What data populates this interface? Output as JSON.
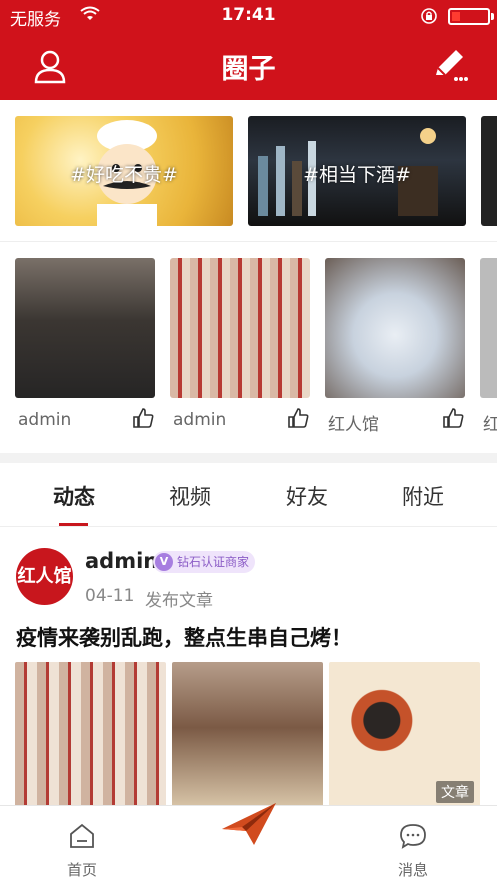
{
  "status_bar": {
    "carrier": "无服务",
    "time": "17:41"
  },
  "nav": {
    "title": "圈子"
  },
  "banners": [
    {
      "label": "#好吃不贵#"
    },
    {
      "label": "#相当下酒#"
    }
  ],
  "feed_cards": [
    {
      "name": "admin"
    },
    {
      "name": "admin"
    },
    {
      "name": "红人馆"
    },
    {
      "name": "红"
    }
  ],
  "tabs": [
    {
      "label": "动态",
      "active": true
    },
    {
      "label": "视频"
    },
    {
      "label": "好友"
    },
    {
      "label": "附近"
    }
  ],
  "post": {
    "avatar_text": "红人馆",
    "author": "admin",
    "badge": "钻石认证商家",
    "badge_icon": "V",
    "date": "04-11",
    "action": "发布文章",
    "title": "疫情来袭别乱跑，整点生串自己烤！",
    "image_tag": "文章"
  },
  "bottom_nav": {
    "home": "首页",
    "messages": "消息"
  },
  "colors": {
    "brand": "#d0121b",
    "tab_underline": "#c8161d",
    "badge_bg": "#efe4fb",
    "badge_text": "#8b5cc6"
  }
}
